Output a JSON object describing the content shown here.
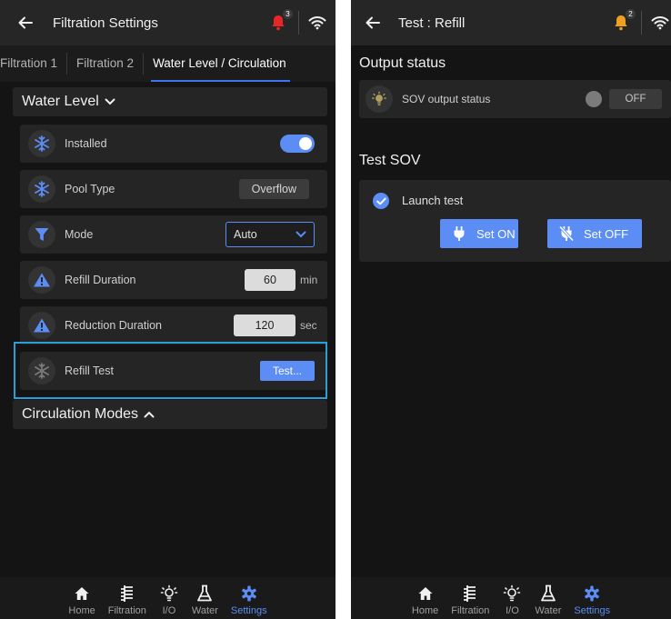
{
  "left": {
    "title": "Filtration Settings",
    "notification_count": "3",
    "tabs": [
      "Filtration 1",
      "Filtration 2",
      "Water Level / Circulation"
    ],
    "water_level_header": "Water Level",
    "rows": {
      "installed": "Installed",
      "pool_type": "Pool Type",
      "pool_type_value": "Overflow",
      "mode": "Mode",
      "mode_value": "Auto",
      "refill_duration": "Refill Duration",
      "refill_value": "60",
      "refill_unit": "min",
      "reduction_duration": "Reduction Duration",
      "reduction_value": "120",
      "reduction_unit": "sec",
      "refill_test": "Refill Test",
      "test_button": "Test..."
    },
    "installed_on": true,
    "circulation_header": "Circulation Modes"
  },
  "right": {
    "title": "Test : Refill",
    "notification_count": "2",
    "output_status_heading": "Output status",
    "sov_output_label": "SOV output status",
    "sov_output_value": "OFF",
    "test_sov_heading": "Test SOV",
    "launch_test": "Launch test",
    "set_on": "Set ON",
    "set_off": "Set OFF"
  },
  "nav": {
    "items": [
      "Home",
      "Filtration",
      "I/O",
      "Water",
      "Settings"
    ],
    "active": "Settings"
  },
  "colors": {
    "accent": "#5b8df5",
    "bell_alert": "#e82626",
    "bell_warning": "#f0a020",
    "highlight": "#2a9ed8",
    "background": "#141414"
  }
}
